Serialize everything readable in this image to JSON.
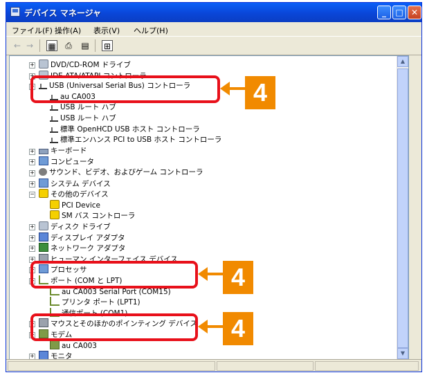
{
  "window": {
    "title": "デバイス マネージャ"
  },
  "menu": [
    "ファイル(F)",
    "操作(A)",
    "表示(V)",
    "ヘルプ(H)"
  ],
  "toolbar": [
    "back-icon",
    "forward-icon",
    "view-icon",
    "print-icon",
    "properties-icon",
    "scan-icon"
  ],
  "tree": [
    {
      "label": "DVD/CD-ROM ドライブ",
      "icon": "disk-icon",
      "expander": "+"
    },
    {
      "label": "IDE ATA/ATAPI コントローラ",
      "icon": "disk-icon",
      "expander": "+"
    },
    {
      "label": "USB (Universal Serial Bus) コントローラ",
      "icon": "usb-icon",
      "expander": "−"
    },
    {
      "label": "au CA003",
      "icon": "usb-icon"
    },
    {
      "label": "USB ルート ハブ",
      "icon": "usb-icon"
    },
    {
      "label": "USB ルート ハブ",
      "icon": "usb-icon"
    },
    {
      "label": "標準 OpenHCD USB ホスト コントローラ",
      "icon": "usb-icon"
    },
    {
      "label": "標準エンハンス PCI to USB ホスト コントローラ",
      "icon": "usb-icon"
    },
    {
      "label": "キーボード",
      "icon": "keyboard-icon",
      "expander": "+"
    },
    {
      "label": "コンピュータ",
      "icon": "computer-icon",
      "expander": "+"
    },
    {
      "label": "サウンド、ビデオ、およびゲーム コントローラ",
      "icon": "sound-icon",
      "expander": "+"
    },
    {
      "label": "システム デバイス",
      "icon": "computer-icon",
      "expander": "+"
    },
    {
      "label": "その他のデバイス",
      "icon": "warning-icon",
      "expander": "−"
    },
    {
      "label": "PCI Device",
      "icon": "warning-icon"
    },
    {
      "label": "SM バス コントローラ",
      "icon": "warning-icon"
    },
    {
      "label": "ディスク ドライブ",
      "icon": "disk-icon",
      "expander": "+"
    },
    {
      "label": "ディスプレイ アダプタ",
      "icon": "monitor-icon",
      "expander": "+"
    },
    {
      "label": "ネットワーク アダプタ",
      "icon": "network-icon",
      "expander": "+"
    },
    {
      "label": "ヒューマン インターフェイス デバイス",
      "icon": "hid-icon",
      "expander": "+"
    },
    {
      "label": "プロセッサ",
      "icon": "computer-icon",
      "expander": "+"
    },
    {
      "label": "ポート (COM と LPT)",
      "icon": "port-icon",
      "expander": "−"
    },
    {
      "label": "au CA003 Serial Port (COM15)",
      "icon": "port-icon"
    },
    {
      "label": "プリンタ ポート (LPT1)",
      "icon": "port-icon"
    },
    {
      "label": "通信ポート (COM1)",
      "icon": "port-icon"
    },
    {
      "label": "マウスとそのほかのポインティング デバイス",
      "icon": "hid-icon",
      "expander": "+"
    },
    {
      "label": "モデム",
      "icon": "modem-icon",
      "expander": "−"
    },
    {
      "label": "au CA003",
      "icon": "modem-icon"
    },
    {
      "label": "モニタ",
      "icon": "monitor-icon",
      "expander": "+"
    }
  ],
  "callouts": [
    {
      "number": "4"
    },
    {
      "number": "4"
    },
    {
      "number": "4"
    }
  ],
  "colors": {
    "highlight": "#e8101a",
    "callout": "#f18a00",
    "titlebar": "#0a50e6"
  }
}
